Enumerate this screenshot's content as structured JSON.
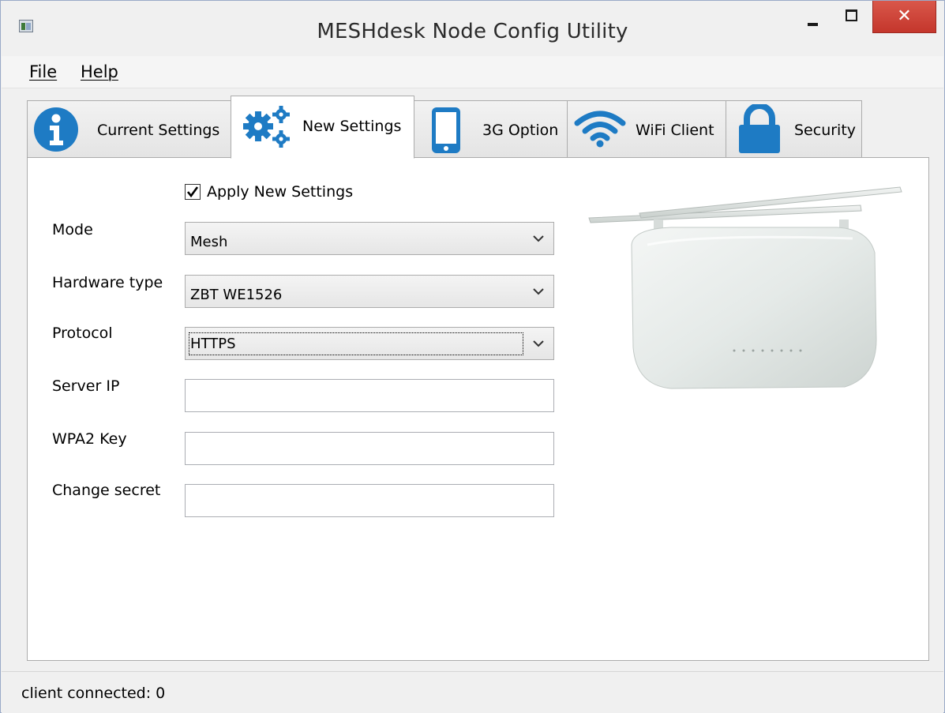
{
  "window": {
    "title": "MESHdesk Node Config Utility",
    "close_glyph": "✕"
  },
  "menu": {
    "file": "File",
    "help": "Help"
  },
  "tabs": [
    {
      "label": "Current Settings",
      "icon": "info-icon",
      "active": false
    },
    {
      "label": "New Settings",
      "icon": "gears-icon",
      "active": true
    },
    {
      "label": "3G Option",
      "icon": "phone-icon",
      "active": false
    },
    {
      "label": "WiFi Client",
      "icon": "wifi-icon",
      "active": false
    },
    {
      "label": "Security",
      "icon": "lock-icon",
      "active": false
    }
  ],
  "form": {
    "apply_label": "Apply New Settings",
    "apply_checked": true,
    "mode_label": "Mode",
    "mode_value": "Mesh",
    "hardware_label": "Hardware type",
    "hardware_value": "ZBT WE1526",
    "protocol_label": "Protocol",
    "protocol_value": "HTTPS",
    "server_ip_label": "Server IP",
    "server_ip_value": "",
    "wpa2_label": "WPA2 Key",
    "wpa2_value": "",
    "secret_label": "Change secret",
    "secret_value": ""
  },
  "status": {
    "text": "client connected: 0"
  },
  "colors": {
    "icon_blue": "#1e7bc4",
    "close_red": "#c7392e",
    "device_body": "#e6ebe9"
  }
}
